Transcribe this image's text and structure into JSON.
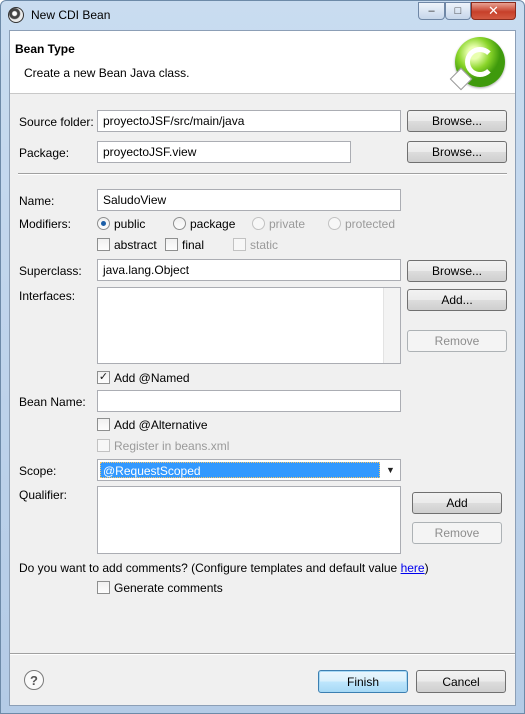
{
  "window": {
    "title": "New CDI Bean",
    "controls": {
      "minimize": "–",
      "maximize": "□",
      "close": "✕"
    }
  },
  "header": {
    "title": "Bean Type",
    "description": "Create a new Bean Java class.",
    "logo_icon": "cdi-bean-icon"
  },
  "source_folder": {
    "label": "Source folder:",
    "value": "proyectoJSF/src/main/java",
    "browse": "Browse..."
  },
  "package": {
    "label": "Package:",
    "value": "proyectoJSF.view",
    "browse": "Browse..."
  },
  "name": {
    "label": "Name:",
    "value": "SaludoView"
  },
  "modifiers": {
    "label": "Modifiers:",
    "public": "public",
    "package": "package",
    "private": "private",
    "protected": "protected",
    "abstract": "abstract",
    "final": "final",
    "static": "static",
    "selected": "public"
  },
  "superclass": {
    "label": "Superclass:",
    "value": "java.lang.Object",
    "browse": "Browse..."
  },
  "interfaces": {
    "label": "Interfaces:",
    "add": "Add...",
    "remove": "Remove"
  },
  "add_named": {
    "label": "Add @Named",
    "checked": true
  },
  "bean_name": {
    "label": "Bean Name:",
    "value": ""
  },
  "add_alternative": {
    "label": "Add @Alternative",
    "checked": false
  },
  "register_beans": {
    "label": "Register in beans.xml",
    "checked": false
  },
  "scope": {
    "label": "Scope:",
    "value": "@RequestScoped"
  },
  "qualifier": {
    "label": "Qualifier:",
    "add": "Add",
    "remove": "Remove"
  },
  "comments": {
    "question": "Do you want to add comments? (Configure templates and default value ",
    "link": "here",
    "close_paren": ")",
    "generate": "Generate comments",
    "checked": false
  },
  "footer": {
    "help": "?",
    "finish": "Finish",
    "cancel": "Cancel"
  },
  "colors": {
    "accent": "#3399ff",
    "title_bar": "#c9dcf0",
    "close_button": "#c7402a"
  }
}
